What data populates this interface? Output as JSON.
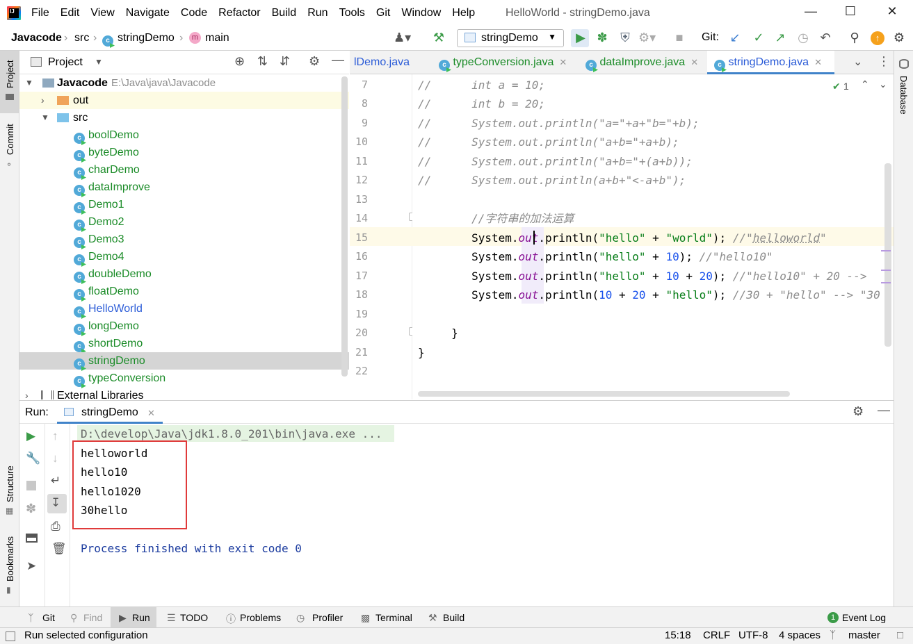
{
  "window": {
    "title": "HelloWorld - stringDemo.java"
  },
  "menu": [
    "File",
    "Edit",
    "View",
    "Navigate",
    "Code",
    "Refactor",
    "Build",
    "Run",
    "Tools",
    "Git",
    "Window",
    "Help"
  ],
  "breadcrumb": {
    "project": "Javacode",
    "folder": "src",
    "class": "stringDemo",
    "method": "main"
  },
  "toolbar": {
    "run_config": "stringDemo",
    "git_label": "Git:"
  },
  "project_panel": {
    "title": "Project",
    "root": {
      "name": "Javacode",
      "path": "E:\\Java\\java\\Javacode"
    },
    "items": [
      {
        "label": "out",
        "kind": "folder"
      },
      {
        "label": "src",
        "kind": "folder"
      },
      {
        "label": "boolDemo",
        "kind": "class"
      },
      {
        "label": "byteDemo",
        "kind": "class"
      },
      {
        "label": "charDemo",
        "kind": "class"
      },
      {
        "label": "dataImprove",
        "kind": "class"
      },
      {
        "label": "Demo1",
        "kind": "class"
      },
      {
        "label": "Demo2",
        "kind": "class"
      },
      {
        "label": "Demo3",
        "kind": "class"
      },
      {
        "label": "Demo4",
        "kind": "class"
      },
      {
        "label": "doubleDemo",
        "kind": "class"
      },
      {
        "label": "floatDemo",
        "kind": "class"
      },
      {
        "label": "HelloWorld",
        "kind": "class"
      },
      {
        "label": "longDemo",
        "kind": "class"
      },
      {
        "label": "shortDemo",
        "kind": "class"
      },
      {
        "label": "stringDemo",
        "kind": "class"
      },
      {
        "label": "typeConversion",
        "kind": "class"
      },
      {
        "label": "External Libraries",
        "kind": "library"
      }
    ]
  },
  "tabs": [
    {
      "label": "lDemo.java"
    },
    {
      "label": "typeConversion.java"
    },
    {
      "label": "dataImprove.java"
    },
    {
      "label": "stringDemo.java",
      "active": true
    }
  ],
  "editor": {
    "inspection_count": "1",
    "line_numbers": [
      "7",
      "8",
      "9",
      "10",
      "11",
      "12",
      "13",
      "14",
      "15",
      "16",
      "17",
      "18",
      "19",
      "20",
      "21",
      "22"
    ]
  },
  "left_strip": {
    "project": "Project",
    "commit": "Commit",
    "structure": "Structure",
    "bookmarks": "Bookmarks"
  },
  "right_strip": {
    "database": "Database"
  },
  "run_panel": {
    "label": "Run:",
    "tab": "stringDemo",
    "command": "D:\\develop\\Java\\jdk1.8.0_201\\bin\\java.exe ...",
    "output": [
      "helloworld",
      "hello10",
      "hello1020",
      "30hello"
    ],
    "exit_message": "Process finished with exit code 0"
  },
  "tool_windows": [
    "Git",
    "Find",
    "Run",
    "TODO",
    "Problems",
    "Profiler",
    "Terminal",
    "Build",
    "Event Log"
  ],
  "status": {
    "message": "Run selected configuration",
    "position": "15:18",
    "line_sep": "CRLF",
    "encoding": "UTF-8",
    "indent": "4 spaces",
    "branch": "master"
  }
}
